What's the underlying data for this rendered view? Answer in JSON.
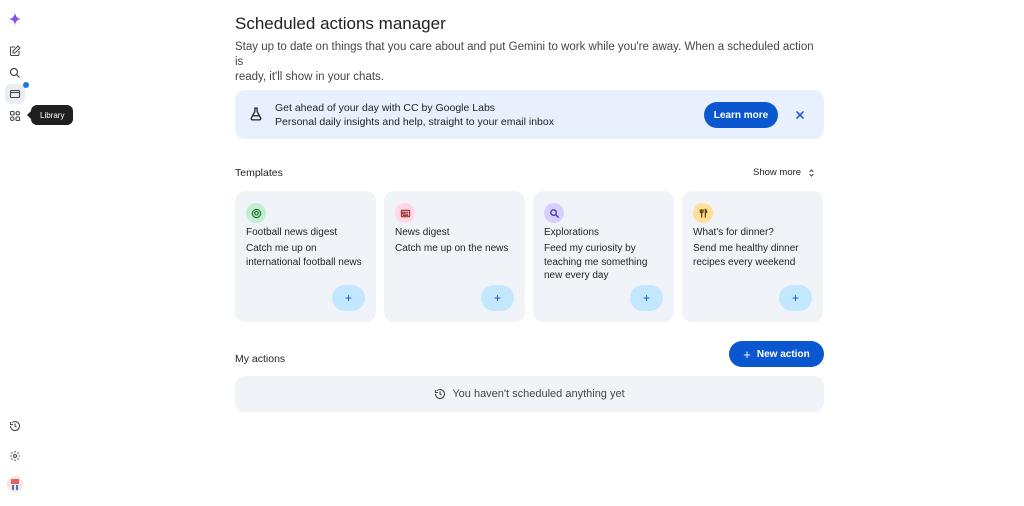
{
  "nav": {
    "items": [
      {
        "name": "gemini-logo",
        "icon": "sparkle-icon"
      },
      {
        "name": "new-chat",
        "icon": "edit-icon"
      },
      {
        "name": "search",
        "icon": "search-icon"
      },
      {
        "name": "library",
        "icon": "library-icon"
      },
      {
        "name": "gems",
        "icon": "apps-icon"
      },
      {
        "name": "activity",
        "icon": "history-icon"
      },
      {
        "name": "settings",
        "icon": "gear-icon"
      }
    ],
    "tooltip": "Library"
  },
  "header": {
    "title": "Scheduled actions manager",
    "subtitle_line1": "Stay up to date on things that you care about and put Gemini to work while you're away. When a scheduled action is",
    "subtitle_line2": "ready, it'll show in your chats."
  },
  "banner": {
    "line1": "Get ahead of your day with CC by Google Labs",
    "line2": "Personal daily insights and help, straight to your email inbox",
    "button": "Learn more"
  },
  "templates": {
    "label": "Templates",
    "show_more": "Show more",
    "cards": [
      {
        "title": "Football news digest",
        "desc": "Catch me up on international football news",
        "icon": "soccer-ball-icon",
        "color": "#c4eed0",
        "add": "+"
      },
      {
        "title": "News digest",
        "desc": "Catch me up on the news",
        "icon": "newspaper-icon",
        "color": "#ffd8e4",
        "add": "+"
      },
      {
        "title": "Explorations",
        "desc": "Feed my curiosity by teaching me something new every day",
        "icon": "search-icon",
        "color": "#d7d0ff",
        "add": "+"
      },
      {
        "title": "What's for dinner?",
        "desc": "Send me healthy dinner recipes every weekend",
        "icon": "utensils-icon",
        "color": "#ffdf99",
        "add": "+"
      }
    ]
  },
  "my_actions": {
    "label": "My actions",
    "new_button": "New action",
    "empty": "You haven't scheduled anything yet"
  },
  "colors": {
    "accent": "#0b57d0",
    "surface": "#f0f4f9",
    "banner": "#e8f0fe"
  }
}
